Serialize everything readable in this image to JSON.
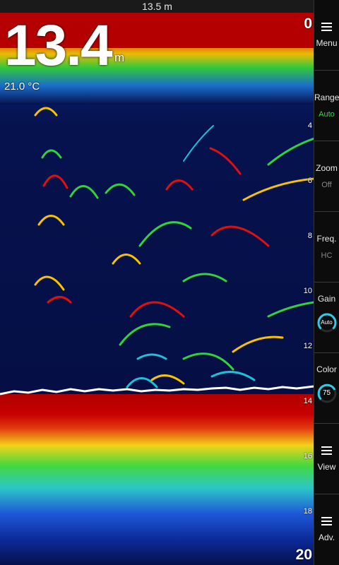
{
  "status_bar": {
    "depth_text": "13.5 m"
  },
  "readout": {
    "depth": "13.4",
    "unit": "m",
    "temperature": "21.0 °C"
  },
  "scale_labels": [
    "0",
    "4",
    "6",
    "8",
    "10",
    "12",
    "14",
    "16",
    "18",
    "20"
  ],
  "menu": {
    "menu_label": "Menu",
    "range_label": "Range",
    "range_value": "Auto",
    "zoom_label": "Zoom",
    "zoom_value": "Off",
    "freq_label": "Freq.",
    "freq_value": "HC",
    "gain_label": "Gain",
    "gain_value": "Auto",
    "color_label": "Color",
    "color_value": "75",
    "view_label": "View",
    "adv_label": "Adv."
  },
  "colors": {
    "accent": "#35c9e8",
    "green_value": "#37d24a",
    "bottom_red": "#b80000",
    "water": "#06114a"
  }
}
